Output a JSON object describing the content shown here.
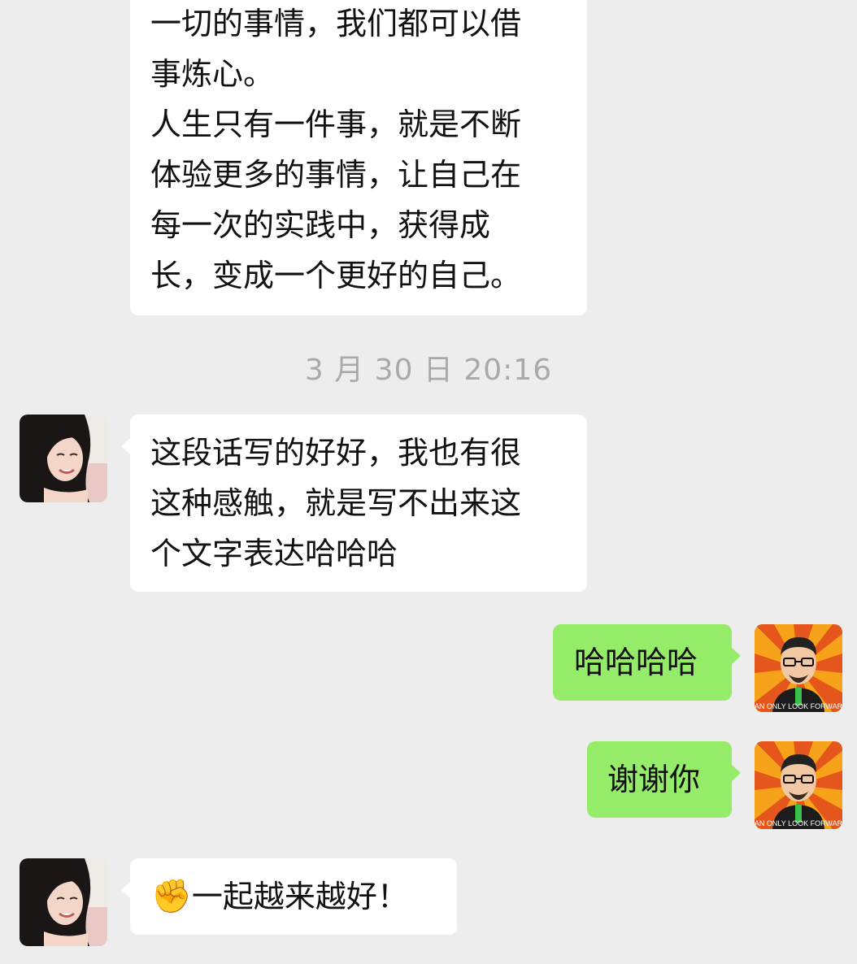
{
  "messages": [
    {
      "side": "in",
      "lines": [
        "一切的事情，我们都可以借",
        "事炼心。",
        "人生只有一件事，就是不断",
        "体验更多的事情，让自己在",
        "每一次的实践中，获得成",
        "长，变成一个更好的自己。"
      ]
    },
    {
      "timestamp": "3 月 30 日 20:16"
    },
    {
      "side": "in",
      "lines": [
        "这段话写的好好，我也有很",
        "这种感触，就是写不出来这",
        "个文字表达哈哈哈"
      ]
    },
    {
      "side": "out",
      "text": "哈哈哈哈"
    },
    {
      "side": "out",
      "text": "谢谢你"
    },
    {
      "side": "in",
      "emoji": "✊",
      "text": "一起越来越好！"
    }
  ],
  "avatars": {
    "self_caption": "CAN ONLY LOOK FORWARD",
    "colors": {
      "sunburst_a": "#f7a21b",
      "sunburst_b": "#e4561c",
      "bubble_out": "#95ec69",
      "bubble_in": "#ffffff",
      "background": "#ededed"
    }
  }
}
